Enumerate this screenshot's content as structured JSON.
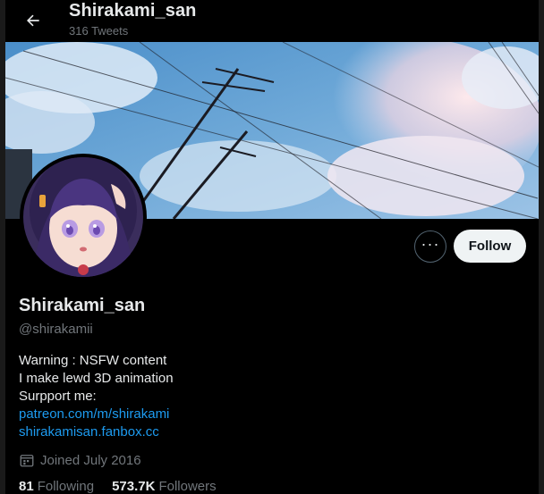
{
  "header": {
    "title": "Shirakami_san",
    "tweet_count": "316 Tweets",
    "back_icon": "arrow-left-icon"
  },
  "actions": {
    "more_label": "···",
    "follow_label": "Follow"
  },
  "profile": {
    "display_name": "Shirakami_san",
    "handle": "@shirakamii",
    "bio_lines": [
      "Warning : NSFW content",
      "I make lewd 3D animation",
      "Surpport me:"
    ],
    "links": [
      "patreon.com/m/shirakami",
      "shirakamisan.fanbox.cc"
    ],
    "joined": "Joined July 2016",
    "following_count": "81",
    "following_label": "Following",
    "followers_count": "573.7K",
    "followers_label": "Followers"
  },
  "colors": {
    "background": "#000000",
    "text": "#e7e9ea",
    "muted": "#71767b",
    "link": "#1d9bf0",
    "follow_bg": "#eff3f4"
  }
}
